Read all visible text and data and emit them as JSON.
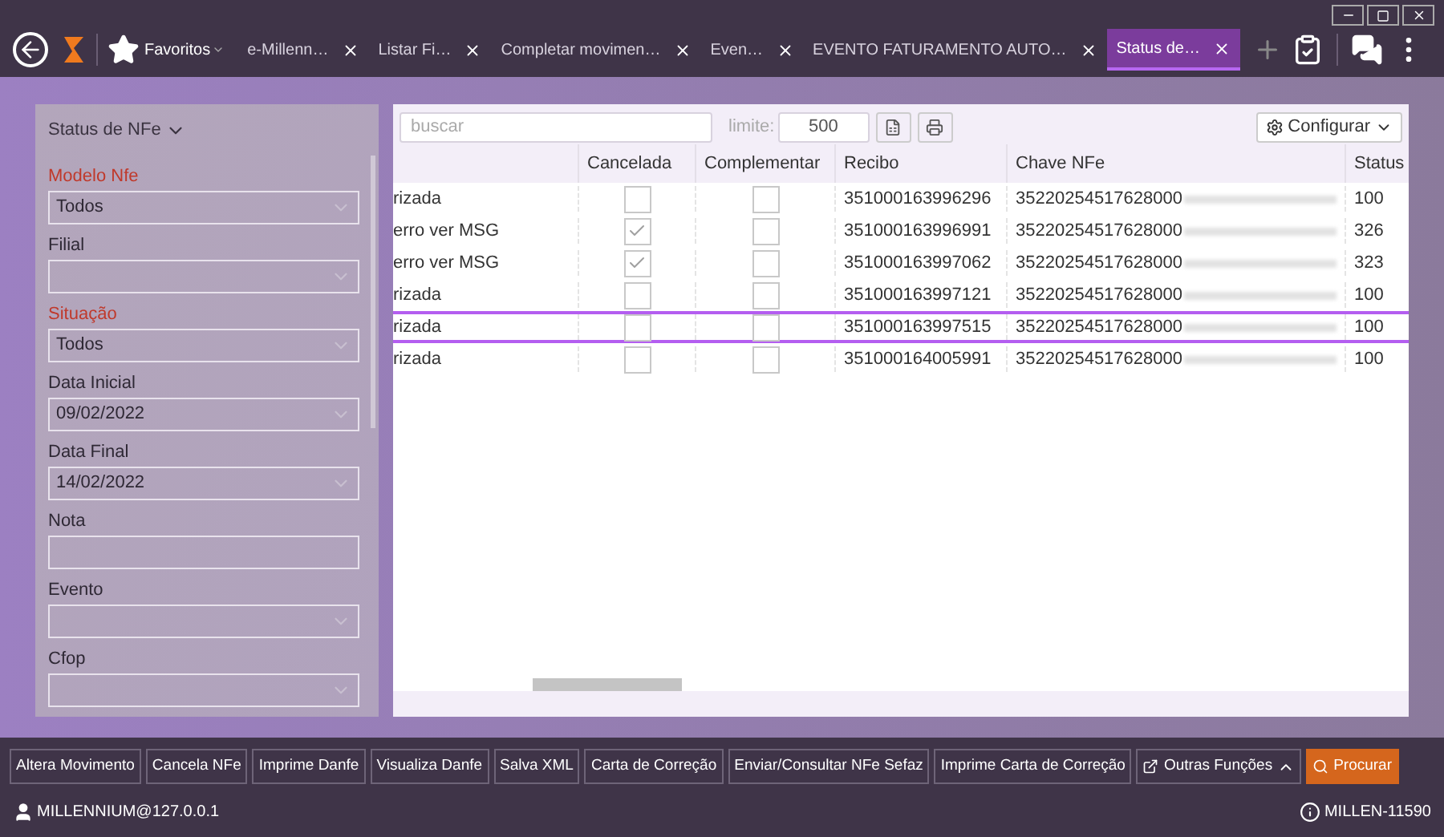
{
  "toolbar": {
    "favorites": "Favoritos"
  },
  "tabs": [
    {
      "label": "e-Millenn…",
      "selected": false
    },
    {
      "label": "Listar Fi…",
      "selected": false
    },
    {
      "label": "Completar movimen…",
      "selected": false
    },
    {
      "label": "Even…",
      "selected": false
    },
    {
      "label": "EVENTO FATURAMENTO AUTO…",
      "selected": false
    },
    {
      "label": "Status de…",
      "selected": true
    }
  ],
  "filter_panel": {
    "title": "Status de NFe",
    "fields": [
      {
        "label": "Modelo Nfe",
        "required": true,
        "kind": "select",
        "value": "Todos"
      },
      {
        "label": "Filial",
        "required": false,
        "kind": "select"
      },
      {
        "label": "Situação",
        "required": true,
        "kind": "select",
        "value": "Todos"
      },
      {
        "label": "Data Inicial",
        "required": false,
        "kind": "select",
        "value": "09/02/2022"
      },
      {
        "label": "Data Final",
        "required": false,
        "kind": "select",
        "value": "14/02/2022"
      },
      {
        "label": "Nota",
        "required": false,
        "kind": "text"
      },
      {
        "label": "Evento",
        "required": false,
        "kind": "select"
      },
      {
        "label": "Cfop",
        "required": false,
        "kind": "select"
      }
    ]
  },
  "grid": {
    "search": {
      "placeholder": "buscar"
    },
    "limit_label": "limite:",
    "limit": "500",
    "configure": "Configurar",
    "columns": [
      "Cancelada",
      "Complementar",
      "Recibo",
      "Chave NFe",
      "Status"
    ],
    "rows": [
      {
        "column_1": "rizada",
        "cancelada": false,
        "complementar": false,
        "recibo": "351000163996296",
        "chave": "35220254517628000",
        "status": "100",
        "selected": false
      },
      {
        "column_1": "erro ver MSG",
        "cancelada": true,
        "complementar": false,
        "recibo": "351000163996991",
        "chave": "35220254517628000",
        "status": "326",
        "selected": false
      },
      {
        "column_1": "erro ver MSG",
        "cancelada": true,
        "complementar": false,
        "recibo": "351000163997062",
        "chave": "35220254517628000",
        "status": "323",
        "selected": false
      },
      {
        "column_1": "rizada",
        "cancelada": false,
        "complementar": false,
        "recibo": "351000163997121",
        "chave": "35220254517628000",
        "status": "100",
        "selected": false
      },
      {
        "column_1": "rizada",
        "cancelada": false,
        "complementar": false,
        "recibo": "351000163997515",
        "chave": "35220254517628000",
        "status": "100",
        "selected": true
      },
      {
        "column_1": "rizada",
        "cancelada": false,
        "complementar": false,
        "recibo": "351000164005991",
        "chave": "35220254517628000",
        "status": "100",
        "selected": false
      }
    ]
  },
  "actions": [
    "Altera Movimento",
    "Cancela NFe",
    "Imprime Danfe",
    "Visualiza Danfe",
    "Salva XML",
    "Carta de Correção",
    "Enviar/Consultar NFe Sefaz",
    "Imprime Carta de Correção"
  ],
  "more_functions": "Outras Funções",
  "search_button": "Procurar",
  "status_bar": {
    "user": "MILLENNIUM@127.0.0.1",
    "version": "MILLEN-11590"
  }
}
